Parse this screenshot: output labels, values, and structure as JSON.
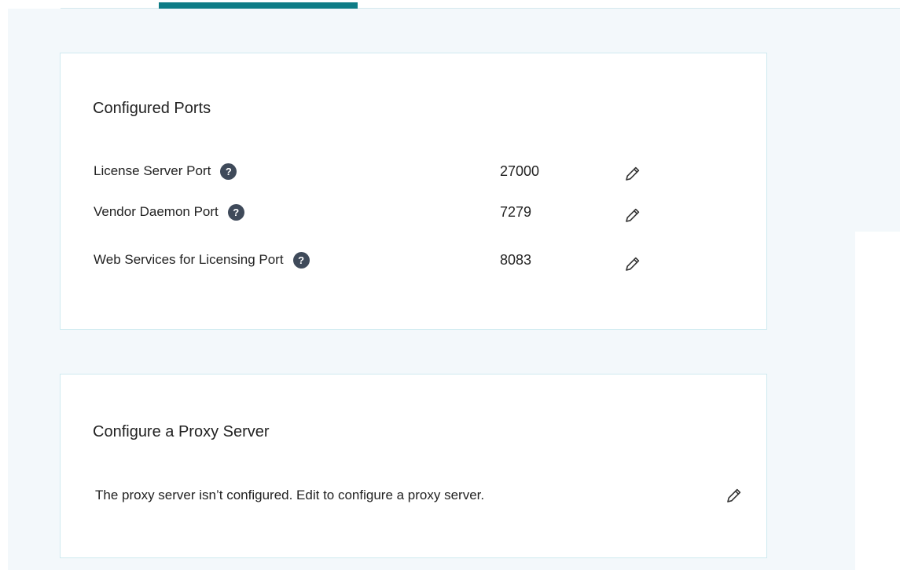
{
  "configured_ports": {
    "title": "Configured Ports",
    "rows": [
      {
        "label": "License Server Port",
        "value": "27000",
        "help_icon": "question-icon",
        "edit_icon": "pencil-icon"
      },
      {
        "label": "Vendor Daemon Port",
        "value": "7279",
        "help_icon": "question-icon",
        "edit_icon": "pencil-icon"
      },
      {
        "label": "Web Services for Licensing Port",
        "value": "8083",
        "help_icon": "question-icon",
        "edit_icon": "pencil-icon"
      }
    ]
  },
  "proxy_server": {
    "title": "Configure a Proxy Server",
    "status_text": "The proxy server isn’t configured. Edit to configure a proxy server.",
    "edit_icon": "pencil-icon"
  },
  "help_glyph": "?",
  "colors": {
    "accent": "#0e7c86",
    "page_background": "#f3f8fb",
    "card_border": "#cfeaf0",
    "help_icon_bg": "#3f4a5a"
  }
}
